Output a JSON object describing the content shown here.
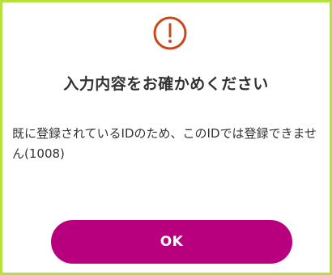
{
  "dialog": {
    "icon": "exclamation-circle-icon",
    "icon_color": "#c8471c",
    "title": "入力内容をお確かめください",
    "message": "既に登録されているIDのため、このIDでは登録できません(1008)",
    "ok_label": "OK",
    "button_color": "#b8007f",
    "border_color": "#b5e13c"
  }
}
